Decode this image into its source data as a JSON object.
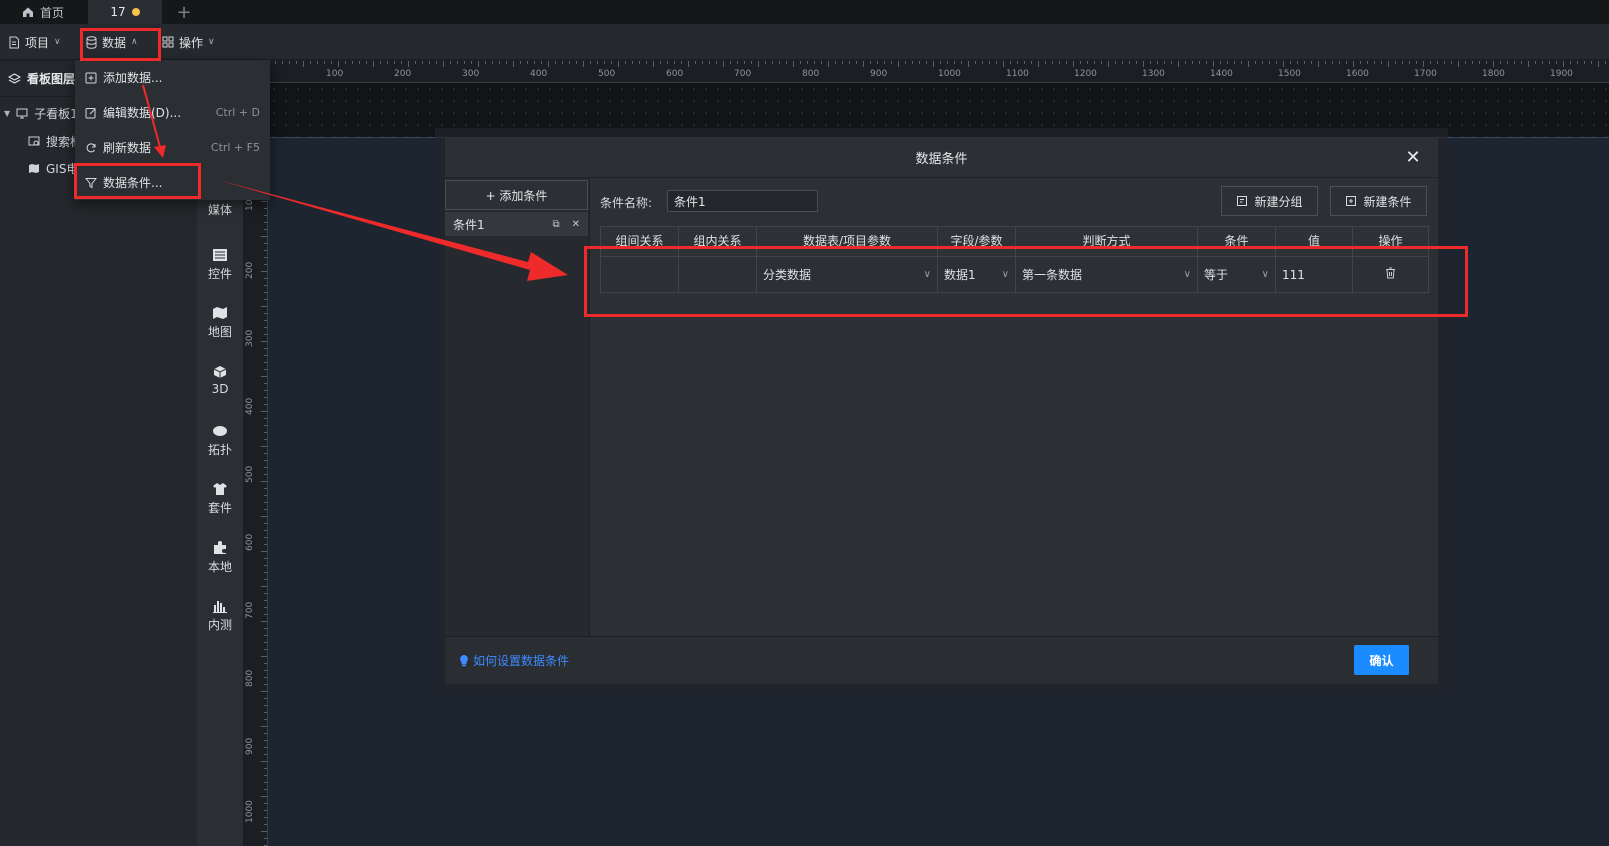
{
  "tabs": {
    "home_label": "首页",
    "active_label": "17",
    "add_label": "+"
  },
  "menubar": {
    "project": "项目",
    "data": "数据",
    "operations": "操作"
  },
  "left_panel": {
    "title": "看板图层",
    "items": [
      {
        "label": "子看板1"
      },
      {
        "label": "搜索框"
      },
      {
        "label": "GIS电网"
      }
    ]
  },
  "rail": {
    "items": [
      {
        "label": "媒体",
        "icon": "media-icon"
      },
      {
        "label": "控件",
        "icon": "widget-icon"
      },
      {
        "label": "地图",
        "icon": "map-icon"
      },
      {
        "label": "3D",
        "icon": "cube-icon"
      },
      {
        "label": "拓扑",
        "icon": "topology-icon"
      },
      {
        "label": "套件",
        "icon": "suite-icon"
      },
      {
        "label": "本地",
        "icon": "puzzle-icon"
      },
      {
        "label": "内测",
        "icon": "bar-chart-icon"
      }
    ]
  },
  "ruler": {
    "h_ticks": [
      "100",
      "200",
      "300",
      "400",
      "500",
      "600",
      "700",
      "800",
      "900",
      "1000",
      "1100",
      "1200",
      "1300",
      "1400",
      "1500",
      "1600",
      "1700",
      "1800",
      "1900"
    ],
    "v_ticks": [
      "100",
      "200",
      "300",
      "400",
      "500",
      "600",
      "700",
      "800",
      "900",
      "1000"
    ]
  },
  "dropdown": {
    "items": [
      {
        "label": "添加数据...",
        "shortcut": ""
      },
      {
        "label": "编辑数据(D)...",
        "shortcut": "Ctrl + D"
      },
      {
        "label": "刷新数据",
        "shortcut": "Ctrl + F5"
      },
      {
        "label": "数据条件...",
        "shortcut": ""
      }
    ]
  },
  "dialog": {
    "title": "数据条件",
    "add_condition": "+ 添加条件",
    "condition_item": "条件1",
    "name_label": "条件名称:",
    "name_value": "条件1",
    "new_group": "新建分组",
    "new_condition": "新建条件",
    "columns": [
      "组间关系",
      "组内关系",
      "数据表/项目参数",
      "字段/参数",
      "判断方式",
      "条件",
      "值",
      "操作"
    ],
    "row": {
      "inter_group": "",
      "intra_group": "",
      "table": "分类数据",
      "field": "数据1",
      "method": "第一条数据",
      "condition": "等于",
      "value": "111"
    },
    "help_link": "如何设置数据条件",
    "confirm": "确认"
  },
  "colors": {
    "accent": "#1a8cff",
    "annotation": "#ee2a2a",
    "link": "#3d8bff",
    "tab_dot": "#f4c34d"
  }
}
